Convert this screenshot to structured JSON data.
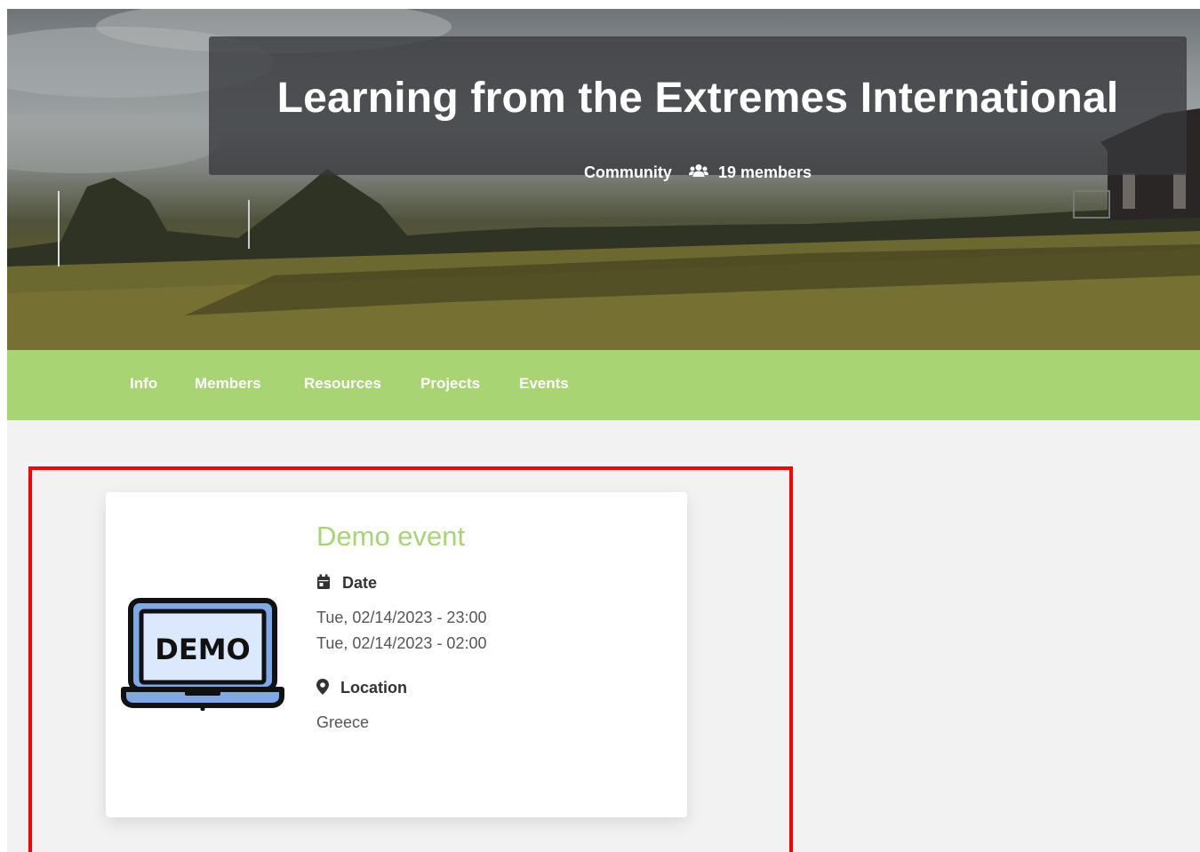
{
  "header": {
    "title": "Learning from the Extremes International",
    "type_label": "Community",
    "members_label": "19 members",
    "members_icon": "users-icon"
  },
  "tabs": [
    {
      "label": "Info"
    },
    {
      "label": "Members"
    },
    {
      "label": "Resources"
    },
    {
      "label": "Projects"
    },
    {
      "label": "Events"
    }
  ],
  "event": {
    "title": "Demo event",
    "image_text": "DEMO",
    "image_icon": "laptop-demo-icon",
    "date_label": "Date",
    "date_icon": "calendar-icon",
    "date_start": "Tue, 02/14/2023 - 23:00",
    "date_end": "Tue, 02/14/2023 - 02:00",
    "location_label": "Location",
    "location_icon": "map-marker-icon",
    "location_value": "Greece"
  },
  "colors": {
    "nav_green": "#a8d473",
    "event_title_green": "#a8d473",
    "highlight_red": "#ff0000",
    "page_background": "#f2f2f2"
  }
}
